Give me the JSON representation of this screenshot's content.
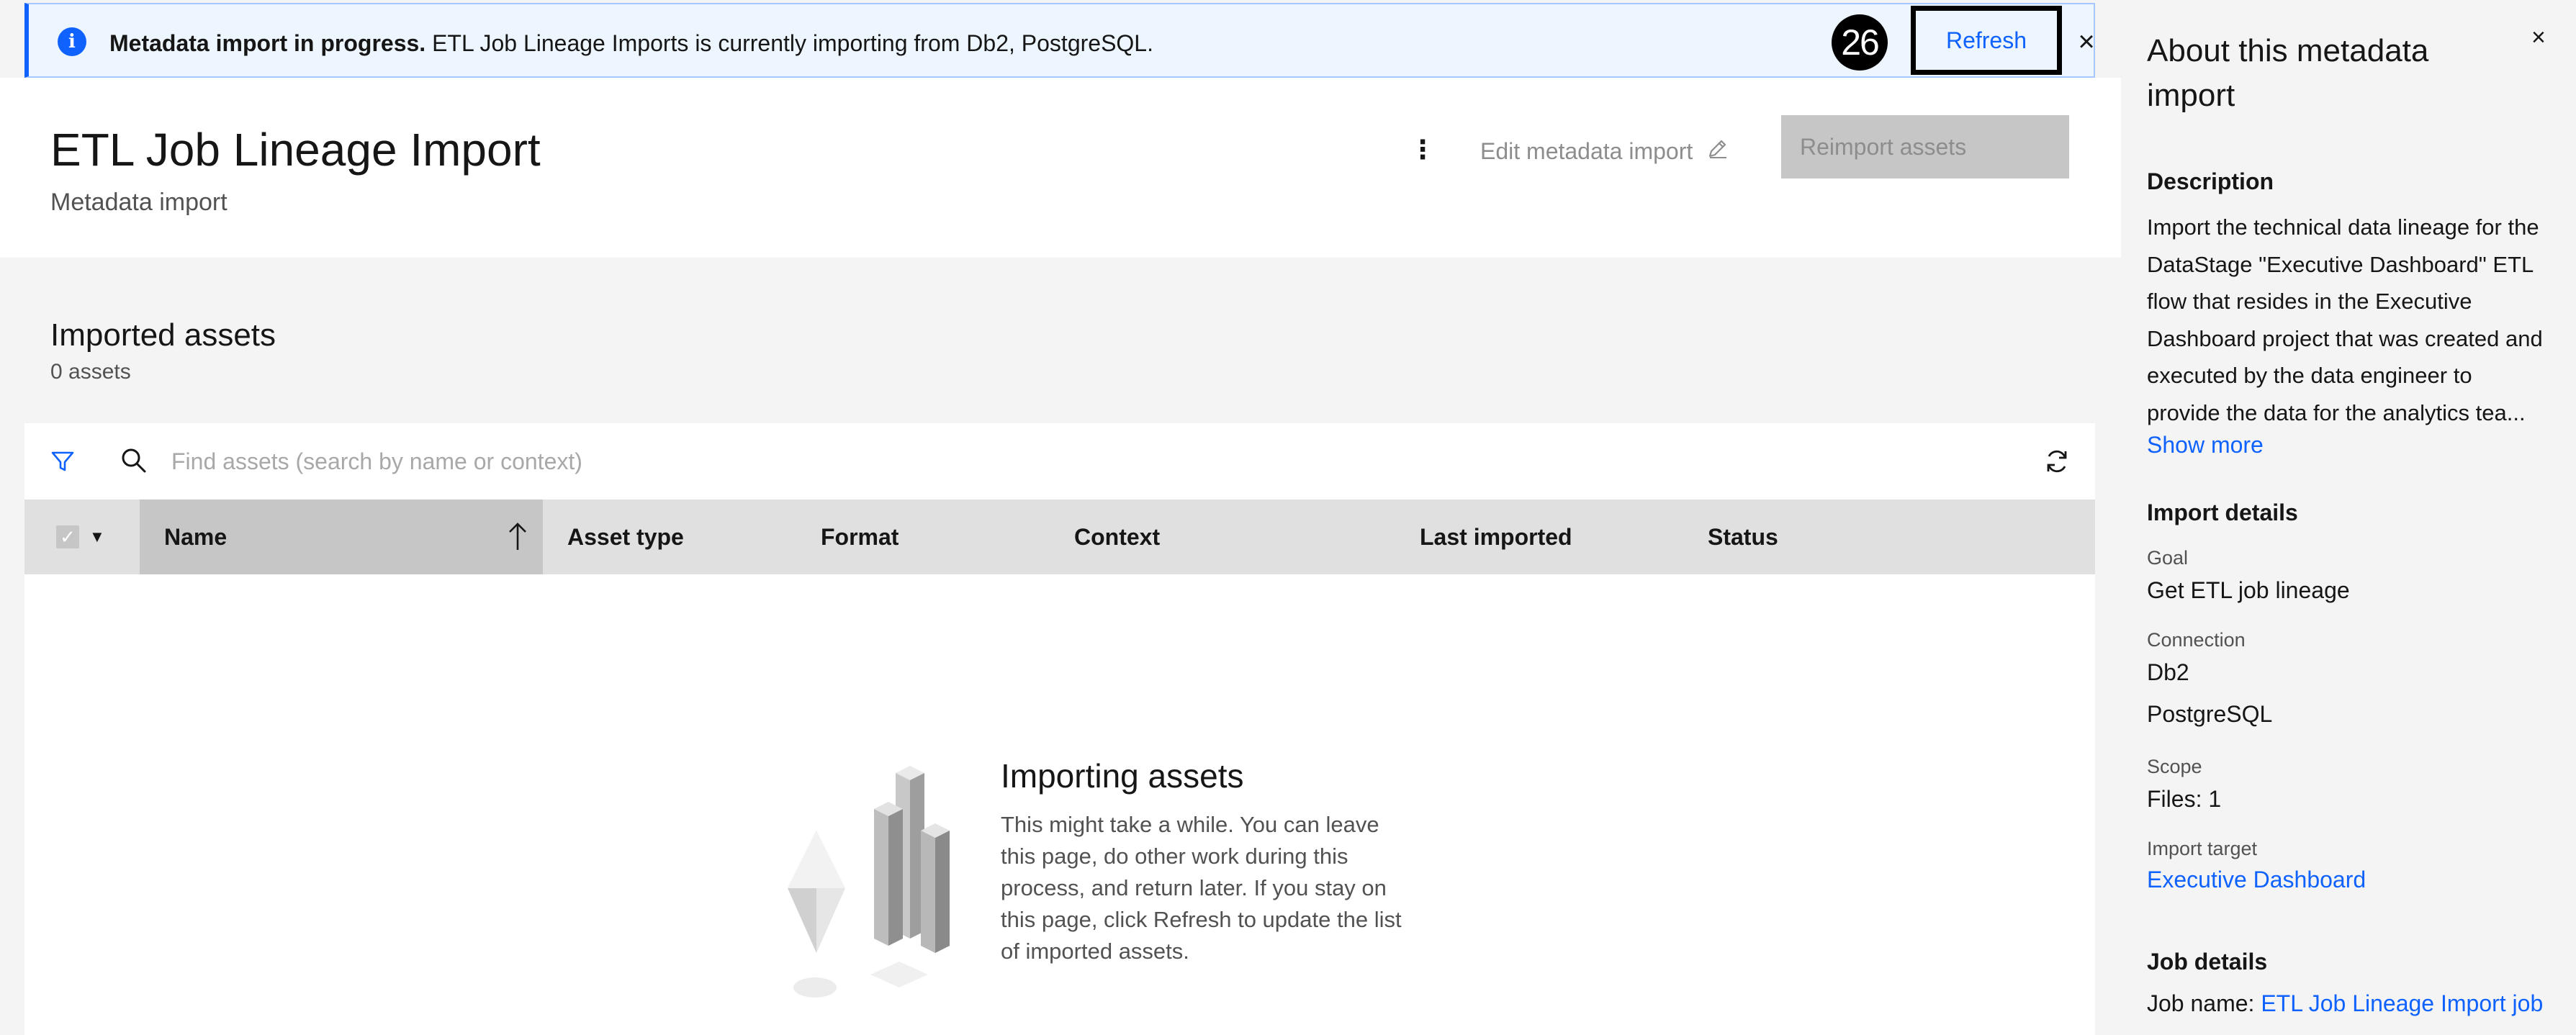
{
  "banner": {
    "title": "Metadata import in progress.",
    "message": "ETL Job Lineage Imports is currently importing from Db2, PostgreSQL.",
    "step_number": "26",
    "refresh_label": "Refresh",
    "close_symbol": "×"
  },
  "header": {
    "title": "ETL Job Lineage Import",
    "subtitle": "Metadata import",
    "overflow_symbol": "⋮",
    "edit_label": "Edit metadata import",
    "reimport_label": "Reimport assets"
  },
  "assets": {
    "title": "Imported assets",
    "count": "0 assets",
    "search_placeholder": "Find assets (search by name or context)",
    "columns": {
      "name": "Name",
      "asset_type": "Asset type",
      "format": "Format",
      "context": "Context",
      "last_imported": "Last imported",
      "status": "Status"
    },
    "empty_state": {
      "title": "Importing assets",
      "text": "This might take a while. You can leave this page, do other work during this process, and return later. If you stay on this page, click Refresh to update the list of imported assets."
    }
  },
  "panel": {
    "title": "About this metadata import",
    "close_symbol": "×",
    "description_heading": "Description",
    "description": "Import the technical data lineage for the DataStage \"Executive Dashboard\" ETL flow that resides in the Executive Dashboard project that was created and executed by the data engineer to provide the data for the analytics tea...",
    "show_more": "Show more",
    "import_details_heading": "Import details",
    "goal_label": "Goal",
    "goal_value": "Get ETL job lineage",
    "connection_label": "Connection",
    "connections": [
      "Db2",
      "PostgreSQL"
    ],
    "scope_label": "Scope",
    "scope_value": "Files: 1",
    "target_label": "Import target",
    "target_value": "Executive Dashboard",
    "job_details_heading": "Job details",
    "job_name_label": "Job name:",
    "job_name_value": "ETL Job Lineage Import job"
  },
  "colors": {
    "accent": "#0f62fe",
    "banner_bg": "#edf5ff",
    "disabled_bg": "#c6c6c6",
    "table_header_bg": "#e0e0e0"
  }
}
